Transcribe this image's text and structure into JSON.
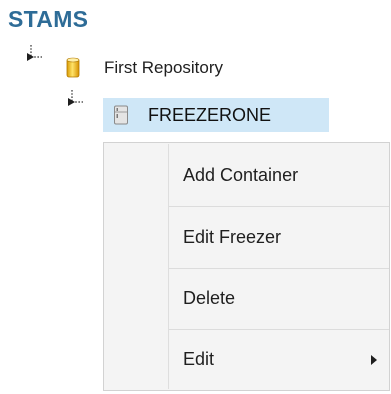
{
  "app": {
    "title": "STAMS"
  },
  "tree": {
    "repository": {
      "label": "First Repository",
      "icon": "repository-cylinder-icon",
      "icon_color": "#f2c318"
    },
    "freezer": {
      "label": "FREEZERONE",
      "icon": "freezer-icon",
      "selected": true,
      "highlight_color": "#cfe7f7"
    }
  },
  "context_menu": {
    "items": [
      {
        "label": "Add Container"
      },
      {
        "label": "Edit Freezer"
      },
      {
        "label": "Delete"
      },
      {
        "label": "Edit",
        "has_submenu": true
      }
    ]
  },
  "colors": {
    "title": "#2e6c97",
    "menu_background": "#f4f4f4"
  }
}
